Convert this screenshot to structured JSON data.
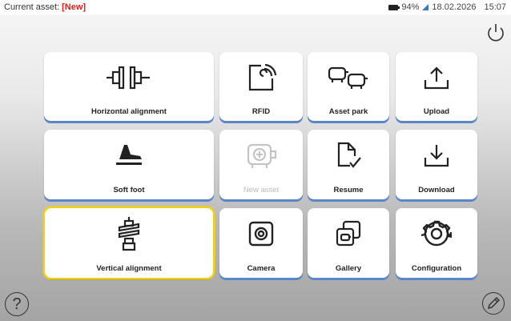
{
  "status": {
    "asset_prefix": "Current asset: ",
    "asset_value": "[New]",
    "battery": "94%",
    "date": "18.02.2026",
    "time": "15:07"
  },
  "tiles": [
    {
      "label": "Horizontal alignment",
      "icon": "horizontal-alignment-icon",
      "enabled": true
    },
    {
      "label": "RFID",
      "icon": "rfid-icon",
      "enabled": true
    },
    {
      "label": "Asset park",
      "icon": "asset-park-icon",
      "enabled": true
    },
    {
      "label": "Upload",
      "icon": "upload-icon",
      "enabled": true
    },
    {
      "label": "Soft foot",
      "icon": "soft-foot-icon",
      "enabled": true
    },
    {
      "label": "New asset",
      "icon": "new-asset-icon",
      "enabled": false
    },
    {
      "label": "Resume",
      "icon": "resume-icon",
      "enabled": true
    },
    {
      "label": "Download",
      "icon": "download-icon",
      "enabled": true
    },
    {
      "label": "Vertical alignment",
      "icon": "vertical-alignment-icon",
      "enabled": true,
      "selected": true
    },
    {
      "label": "Camera",
      "icon": "camera-icon",
      "enabled": true
    },
    {
      "label": "Gallery",
      "icon": "gallery-icon",
      "enabled": true
    },
    {
      "label": "Configuration",
      "icon": "gear-icon",
      "enabled": true
    }
  ],
  "help_label": "?",
  "colors": {
    "accent": "#5a86c9",
    "selected": "#f4d10a",
    "new_asset_tag": "#e21b1b"
  }
}
